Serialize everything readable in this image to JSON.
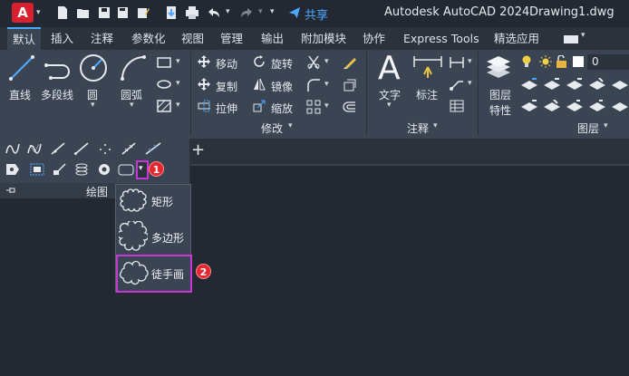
{
  "titlebar": {
    "app_logo": "A",
    "share_label": "共享",
    "app_title": "Autodesk AutoCAD 2024",
    "file_name": "Drawing1.dwg"
  },
  "tabs": [
    "默认",
    "插入",
    "注释",
    "参数化",
    "视图",
    "管理",
    "输出",
    "附加模块",
    "协作",
    "Express Tools",
    "精选应用"
  ],
  "active_tab": "默认",
  "draw_group": {
    "tools": [
      "直线",
      "多段线",
      "圆",
      "圆弧"
    ],
    "panel_label": "绘图"
  },
  "modify_group": {
    "tools": [
      "移动",
      "旋转",
      "复制",
      "镜像",
      "拉伸",
      "缩放"
    ],
    "panel_label": "修改"
  },
  "annotation_group": {
    "tools": [
      "文字",
      "标注"
    ],
    "panel_label": "注释"
  },
  "layer_group": {
    "tool": "图层\n特性",
    "tool_line1": "图层",
    "tool_line2": "特性",
    "layer_value": "0",
    "panel_label": "图层"
  },
  "dropdown": {
    "items": [
      "矩形",
      "多边形",
      "徒手画"
    ]
  },
  "badges": [
    "1",
    "2"
  ],
  "colors": {
    "accent": "#4ea7ff",
    "highlight": "#c637d6",
    "badge": "#e2272f",
    "logo": "#d8202f"
  }
}
